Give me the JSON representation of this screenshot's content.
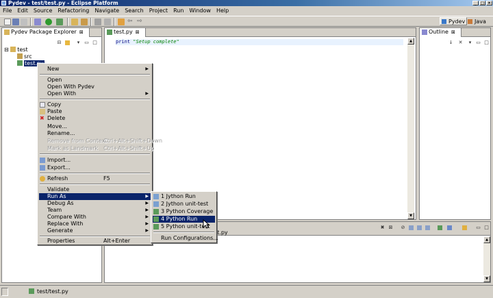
{
  "window": {
    "title": "Pydev - test/test.py - Eclipse Platform"
  },
  "menubar": [
    "File",
    "Edit",
    "Source",
    "Refactoring",
    "Navigate",
    "Search",
    "Project",
    "Run",
    "Window",
    "Help"
  ],
  "perspectives": {
    "pydev": "Pydev",
    "java": "Java"
  },
  "explorer": {
    "tab_label": "Pydev Package Explorer",
    "tree": [
      {
        "label": "test",
        "expander": "⊟"
      },
      {
        "label": "src"
      },
      {
        "label": "test.py"
      }
    ]
  },
  "editor": {
    "tab_label": "test.py",
    "code": {
      "keyword": "print",
      "string": "\"Setup complete\""
    }
  },
  "outline": {
    "tab_label": "Outline"
  },
  "console": {
    "partial_text": "st.py"
  },
  "context_menu": {
    "items": {
      "new": "New",
      "open": "Open",
      "open_with_pydev": "Open With Pydev",
      "open_with": "Open With",
      "copy": "Copy",
      "paste": "Paste",
      "delete": "Delete",
      "move": "Move...",
      "rename": "Rename...",
      "remove_from_context": "Remove from Context",
      "remove_from_context_acc": "Ctrl+Alt+Shift+Down",
      "mark_landmark": "Mark as Landmark",
      "mark_landmark_acc": "Ctrl+Alt+Shift+Up",
      "import": "Import...",
      "export": "Export...",
      "refresh": "Refresh",
      "refresh_acc": "F5",
      "validate": "Validate",
      "run_as": "Run As",
      "debug_as": "Debug As",
      "team": "Team",
      "compare_with": "Compare With",
      "replace_with": "Replace With",
      "generate": "Generate",
      "properties": "Properties",
      "properties_acc": "Alt+Enter"
    }
  },
  "run_as_menu": {
    "items": {
      "jython_run": "1 Jython Run",
      "jython_unit": "2 Jython unit-test",
      "python_coverage": "3 Python Coverage",
      "python_run": "4 Python Run",
      "python_unit": "5 Python unit-test",
      "run_configs": "Run Configurations..."
    }
  },
  "status": {
    "selected": "test/test.py"
  },
  "colors": {
    "highlight": "#0a246a",
    "string": "#008000",
    "keyword": "#000080"
  }
}
